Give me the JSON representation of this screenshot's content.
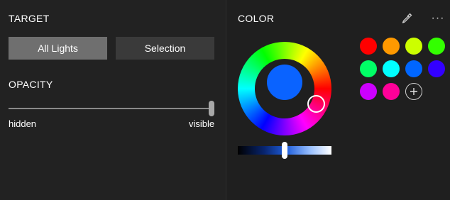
{
  "target": {
    "title": "TARGET",
    "buttons": [
      {
        "label": "All Lights",
        "state": "active"
      },
      {
        "label": "Selection",
        "state": "inactive"
      }
    ]
  },
  "opacity": {
    "title": "OPACITY",
    "min_label": "hidden",
    "max_label": "visible",
    "value_fraction": 1.0
  },
  "color": {
    "title": "COLOR",
    "selected": "#0a63ff",
    "brightness_fraction": 0.5,
    "swatches": [
      "#ff0000",
      "#ff9900",
      "#ccff00",
      "#33ff00",
      "#00ff66",
      "#00ffff",
      "#0066ff",
      "#3300ff",
      "#cc00ff",
      "#ff0099"
    ]
  },
  "icons": {
    "eyedropper": "eyedropper-icon",
    "more": "more-icon",
    "add": "plus-icon"
  }
}
